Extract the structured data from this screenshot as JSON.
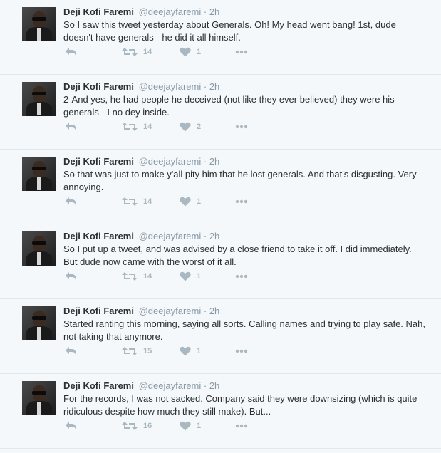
{
  "tweets": [
    {
      "name": "Deji Kofi Faremi",
      "handle": "@deejayfaremi",
      "separator": "·",
      "time": "2h",
      "text": "So I saw this tweet yesterday about Generals. Oh! My head went bang! 1st, dude doesn't have generals - he did it all himself.",
      "retweets": "14",
      "likes": "1"
    },
    {
      "name": "Deji Kofi Faremi",
      "handle": "@deejayfaremi",
      "separator": "·",
      "time": "2h",
      "text": "2-And yes, he had people he deceived (not like they ever believed) they were his generals - I no dey inside.",
      "retweets": "14",
      "likes": "2"
    },
    {
      "name": "Deji Kofi Faremi",
      "handle": "@deejayfaremi",
      "separator": "·",
      "time": "2h",
      "text": "So that was just to make y'all pity him that he lost generals. And that's disgusting. Very annoying.",
      "retweets": "14",
      "likes": "1"
    },
    {
      "name": "Deji Kofi Faremi",
      "handle": "@deejayfaremi",
      "separator": "·",
      "time": "2h",
      "text": "So I put up a tweet, and was advised by a close friend to take it off. I did immediately. But dude now came with the worst of it all.",
      "retweets": "14",
      "likes": "1"
    },
    {
      "name": "Deji Kofi Faremi",
      "handle": "@deejayfaremi",
      "separator": "·",
      "time": "2h",
      "text": "Started ranting this morning, saying all sorts. Calling names and trying to play safe. Nah, not taking that anymore.",
      "retweets": "15",
      "likes": "1"
    },
    {
      "name": "Deji Kofi Faremi",
      "handle": "@deejayfaremi",
      "separator": "·",
      "time": "2h",
      "text": "For the records, I was not sacked. Company said they were downsizing (which is quite ridiculous despite how much they still make). But...",
      "retweets": "16",
      "likes": "1"
    }
  ],
  "icons": {
    "reply": "reply-icon",
    "retweet": "retweet-icon",
    "like": "heart-icon",
    "more": "more-dots-icon"
  },
  "colors": {
    "background": "#f5f8fa",
    "text": "#292f33",
    "muted": "#8899a6",
    "icon": "#aab8c2",
    "divider": "#e1e8ed"
  }
}
